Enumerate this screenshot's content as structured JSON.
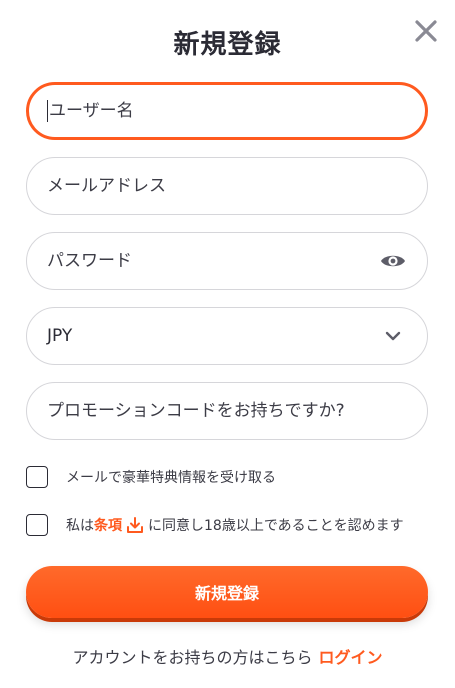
{
  "header": {
    "title": "新規登録",
    "close_icon": "close-icon"
  },
  "form": {
    "username": {
      "placeholder": "ユーザー名",
      "value": ""
    },
    "email": {
      "placeholder": "メールアドレス",
      "value": ""
    },
    "password": {
      "placeholder": "パスワード",
      "value": "",
      "toggle_icon": "eye-icon"
    },
    "currency": {
      "selected": "JPY",
      "icon": "chevron-down-icon"
    },
    "promo": {
      "placeholder": "プロモーションコードをお持ちですか?",
      "value": ""
    },
    "checkbox_promo": {
      "label": "メールで豪華特典情報を受け取る",
      "checked": false
    },
    "checkbox_terms": {
      "prefix": "私は",
      "link": "条項",
      "link_icon": "download-icon",
      "suffix": "に同意し18歳以上であることを認めます",
      "checked": false
    },
    "submit_label": "新規登録"
  },
  "footer": {
    "text": "アカウントをお持ちの方はこちら",
    "login_label": "ログイン"
  },
  "colors": {
    "accent": "#ff5a1f",
    "text": "#2b2b35",
    "border": "#d6d6da"
  }
}
